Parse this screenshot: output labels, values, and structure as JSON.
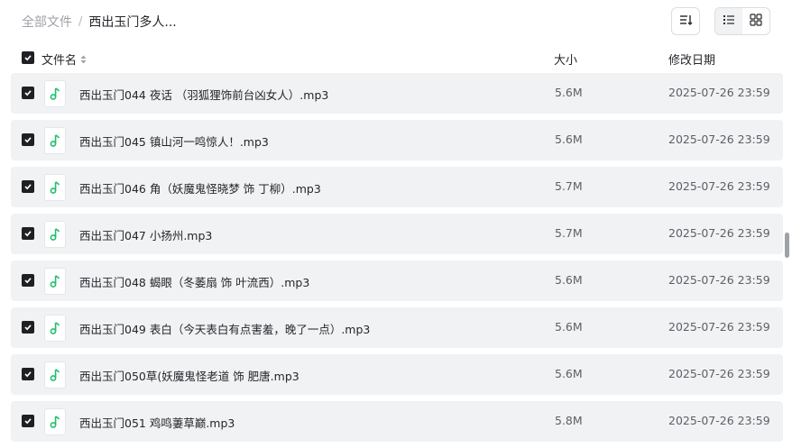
{
  "breadcrumb": {
    "root": "全部文件",
    "separator": "/",
    "current": "西出玉门多人..."
  },
  "toolbar": {
    "sort_icon": "sort-icon",
    "list_view_icon": "list-view-icon",
    "grid_view_icon": "grid-view-icon",
    "active_view": "list"
  },
  "table_header": {
    "name": "文件名",
    "size": "大小",
    "date": "修改日期"
  },
  "colors": {
    "row_bg": "#f1f2f4",
    "checkbox": "#1f2023",
    "audio_icon": "#1fbf6a"
  },
  "files": [
    {
      "name": "西出玉门044 夜话 （羽狐狸饰前台凶女人）.mp3",
      "size": "5.6M",
      "date": "2025-07-26 23:59"
    },
    {
      "name": "西出玉门045 镇山河一鸣惊人！.mp3",
      "size": "5.6M",
      "date": "2025-07-26 23:59"
    },
    {
      "name": "西出玉门046 角（妖魔鬼怪晓梦 饰 丁柳）.mp3",
      "size": "5.7M",
      "date": "2025-07-26 23:59"
    },
    {
      "name": "西出玉门047 小扬州.mp3",
      "size": "5.7M",
      "date": "2025-07-26 23:59"
    },
    {
      "name": "西出玉门048 蝎眼（冬萎扇 饰 叶流西）.mp3",
      "size": "5.6M",
      "date": "2025-07-26 23:59"
    },
    {
      "name": "西出玉门049 表白（今天表白有点害羞，晚了一点）.mp3",
      "size": "5.6M",
      "date": "2025-07-26 23:59"
    },
    {
      "name": "西出玉门050草(妖魔鬼怪老道 饰 肥唐.mp3",
      "size": "5.6M",
      "date": "2025-07-26 23:59"
    },
    {
      "name": "西出玉门051 鸡鸣萋草巅.mp3",
      "size": "5.8M",
      "date": "2025-07-26 23:59"
    }
  ]
}
